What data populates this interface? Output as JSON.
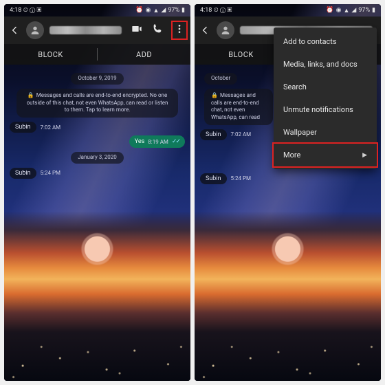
{
  "status": {
    "time": "4:18",
    "indicators": "",
    "battery_pct": "97%"
  },
  "appbar": {
    "contact_name": "",
    "icons": {
      "video": "video-icon",
      "call": "phone-icon",
      "overflow": "overflow-icon"
    }
  },
  "strip": {
    "block": "BLOCK",
    "add": "ADD"
  },
  "chat": {
    "date1": "October 9, 2019",
    "encryption_notice": "Messages and calls are end-to-end encrypted. No one outside of this chat, not even WhatsApp, can read or listen to them. Tap to learn more.",
    "sender": "Subin",
    "time1": "7:02 AM",
    "reply_text": "Yes",
    "reply_time": "8:19 AM",
    "date2": "January 3, 2020",
    "time2": "5:24 PM"
  },
  "menu": {
    "items": [
      "Add to contacts",
      "Media, links, and docs",
      "Search",
      "Unmute notifications",
      "Wallpaper",
      "More"
    ]
  },
  "colors": {
    "accent": "#0f7a5b",
    "highlight": "#d22222"
  }
}
